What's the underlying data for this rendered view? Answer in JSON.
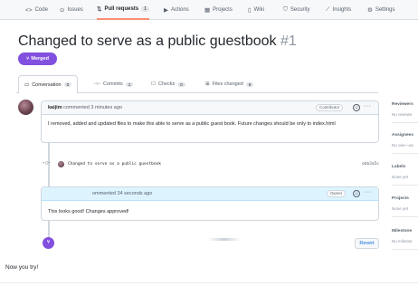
{
  "repo_nav": {
    "tabs": [
      {
        "icon": "code-icon",
        "glyph": "<>",
        "label": "Code",
        "count": null
      },
      {
        "icon": "issues-icon",
        "glyph": "⊙",
        "label": "Issues",
        "count": null
      },
      {
        "icon": "pull-request-icon",
        "glyph": "⇅",
        "label": "Pull requests",
        "count": "1"
      },
      {
        "icon": "actions-icon",
        "glyph": "▶",
        "label": "Actions",
        "count": null
      },
      {
        "icon": "projects-icon",
        "glyph": "▦",
        "label": "Projects",
        "count": null
      },
      {
        "icon": "wiki-icon",
        "glyph": "▯",
        "label": "Wiki",
        "count": null
      },
      {
        "icon": "security-icon",
        "glyph": "⛉",
        "label": "Security",
        "count": null
      },
      {
        "icon": "insights-icon",
        "glyph": "⟋",
        "label": "Insights",
        "count": null
      },
      {
        "icon": "settings-icon",
        "glyph": "⚙",
        "label": "Settings",
        "count": null
      }
    ]
  },
  "pr": {
    "title": "Changed to serve as a public guestbook",
    "number": "#1",
    "status": "Merged",
    "status_color": "#8250df"
  },
  "pr_tabs": [
    {
      "icon": "conversation-icon",
      "glyph": "▭",
      "label": "Conversation",
      "count": "0"
    },
    {
      "icon": "commits-icon",
      "glyph": "-○-",
      "label": "Commits",
      "count": "1"
    },
    {
      "icon": "checks-icon",
      "glyph": "☐",
      "label": "Checks",
      "count": "0"
    },
    {
      "icon": "files-changed-icon",
      "glyph": "⊞",
      "label": "Files changed",
      "count": "6"
    }
  ],
  "comments": [
    {
      "author": "kaijim",
      "meta": "commented 3 minutes ago",
      "role": "Contributor",
      "body": "I removed, added and updated files to make this able to serve as a public guest book. Future changes should be only to index.html"
    },
    {
      "author": "",
      "meta": "ommented 34 seconds ago",
      "role": "Owner",
      "body": "This looks good! Changes approved!"
    }
  ],
  "commit": {
    "message": "Changed to serve as a public guestbook",
    "sha": "ebb3a5c"
  },
  "merge": {
    "revert_label": "Revert"
  },
  "sidebar": [
    {
      "heading": "Reviewers",
      "value": "No reviews"
    },
    {
      "heading": "Assignees",
      "value": "No one—as"
    },
    {
      "heading": "Labels",
      "value": "None yet"
    },
    {
      "heading": "Projects",
      "value": "None yet"
    },
    {
      "heading": "Milestone",
      "value": "No milestor"
    }
  ],
  "footer": {
    "text": "Now you try!"
  }
}
